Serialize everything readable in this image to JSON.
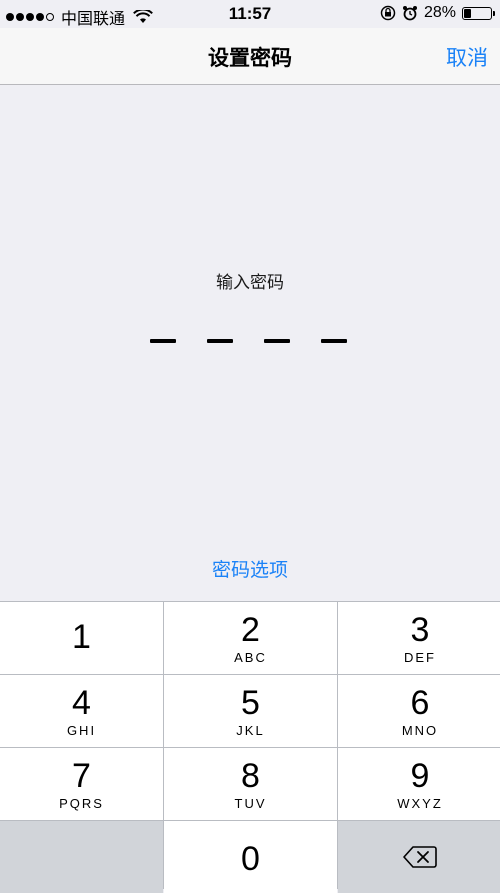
{
  "status_bar": {
    "carrier": "中国联通",
    "time": "11:57",
    "battery": "28%",
    "battery_level": 0.28
  },
  "nav": {
    "title": "设置密码",
    "cancel": "取消"
  },
  "passcode": {
    "prompt": "输入密码",
    "length": 4,
    "options": "密码选项"
  },
  "keypad": {
    "keys": [
      {
        "num": "1",
        "letters": ""
      },
      {
        "num": "2",
        "letters": "ABC"
      },
      {
        "num": "3",
        "letters": "DEF"
      },
      {
        "num": "4",
        "letters": "GHI"
      },
      {
        "num": "5",
        "letters": "JKL"
      },
      {
        "num": "6",
        "letters": "MNO"
      },
      {
        "num": "7",
        "letters": "PQRS"
      },
      {
        "num": "8",
        "letters": "TUV"
      },
      {
        "num": "9",
        "letters": "WXYZ"
      },
      {
        "num": "0",
        "letters": ""
      }
    ],
    "delete_icon": "delete-backspace-icon"
  },
  "colors": {
    "accent": "#1a82f7",
    "background": "#efeff4",
    "keypad_gray": "#d1d4d9"
  }
}
